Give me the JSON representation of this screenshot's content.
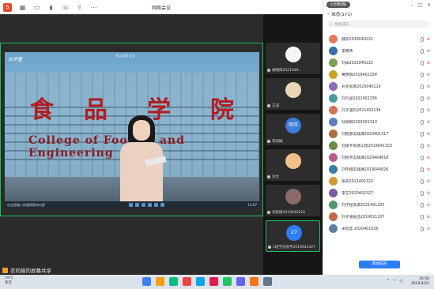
{
  "window": {
    "title": "网络会议",
    "tools": [
      "logo-icon",
      "grid-icon",
      "video-icon",
      "mic-icon",
      "phone-icon",
      "share-icon",
      "more-icon"
    ]
  },
  "stage": {
    "screen_brand": "云学堂",
    "screen_top_text": "食品学院 会议",
    "sign_cn": [
      "食",
      "品",
      "学",
      "院"
    ],
    "sign_en": "College of Food ... and Engineering",
    "slide_caption": "正在观看 共享屏幕",
    "presenter_label": "衣同娟的屏幕共享",
    "inner_taskbar_left": "在这里输入你要搜索的内容",
    "inner_taskbar_right": "14:07"
  },
  "thumbnails": [
    {
      "name": "胡明阳2021049...",
      "avatar": "dog",
      "active": true
    },
    {
      "name": "王淇",
      "avatar": "dog2",
      "active": false
    },
    {
      "name": "衣同娟",
      "avatar": "明伟",
      "active": false
    },
    {
      "name": "刘文",
      "avatar": "kid",
      "active": false
    },
    {
      "name": "刘泉旭2019040222",
      "avatar": "girl",
      "active": false
    },
    {
      "name": "1班学员张宇2019042327",
      "avatar": "27",
      "active": false
    }
  ],
  "panel": {
    "user_badge": "小华明(我)",
    "header": "成员(171)",
    "search_placeholder": "搜索成员",
    "invite_label": "添加成员",
    "members": [
      {
        "name": "薛欣2019040221",
        "color": "#e07a5f"
      },
      {
        "name": "李明伟",
        "color": "#3d6fa8"
      },
      {
        "name": "刘卓2021040222",
        "color": "#7aa05a"
      },
      {
        "name": "黄明阳2019402334",
        "color": "#c9a227"
      },
      {
        "name": "补充资源2020040110",
        "color": "#8e6bb5"
      },
      {
        "name": "刘凡亮2021401336",
        "color": "#4a9d9c"
      },
      {
        "name": "刘子涵刘2021402134",
        "color": "#d0735b"
      },
      {
        "name": "孙欣桐2020401313",
        "color": "#5b7fbd"
      },
      {
        "name": "刘程豪实践课2020401317",
        "color": "#a86f3c"
      },
      {
        "name": "刘泽宇资源工程2019041323",
        "color": "#6c8c4a"
      },
      {
        "name": "刘程宇实践课2020404816",
        "color": "#b35f8a"
      },
      {
        "name": "刘宇翔实践课2019044826",
        "color": "#3c7aa8"
      },
      {
        "name": "张同2021402322",
        "color": "#d19a35"
      },
      {
        "name": "李芯2020402327",
        "color": "#7b5ea7"
      },
      {
        "name": "刘子程资源2021401205",
        "color": "#4f9b6e"
      },
      {
        "name": "刘子涵食品2019021207",
        "color": "#c06a4a"
      },
      {
        "name": "米欣蓝 2020401635",
        "color": "#5d7fa3"
      }
    ]
  },
  "taskbar": {
    "weather_temp": "19°C",
    "weather_desc": "多云",
    "time": "16:56",
    "date": "2022/4/22",
    "apps": [
      "#3b82f6",
      "#f59e0b",
      "#10b981",
      "#ef4444",
      "#0ea5e9",
      "#e11d48",
      "#22c55e",
      "#6366f1",
      "#f97316",
      "#64748b"
    ]
  }
}
